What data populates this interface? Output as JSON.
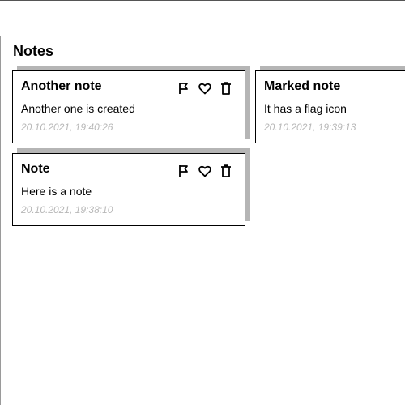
{
  "page": {
    "section_title": "Notes"
  },
  "notes": [
    {
      "title": "Another note",
      "body": "Another one is created",
      "timestamp": "20.10.2021, 19:40:26"
    },
    {
      "title": "Marked note",
      "body": "It has a flag icon",
      "timestamp": "20.10.2021, 19:39:13"
    },
    {
      "title": "Note",
      "body": "Here is a note",
      "timestamp": "20.10.2021, 19:38:10"
    }
  ],
  "icons": {
    "flag": "flag-icon",
    "favorite": "heart-icon",
    "delete": "trash-icon"
  },
  "colors": {
    "card_shadow": "#b5b5b5",
    "timestamp": "#b7b7b7",
    "border": "#000000"
  }
}
